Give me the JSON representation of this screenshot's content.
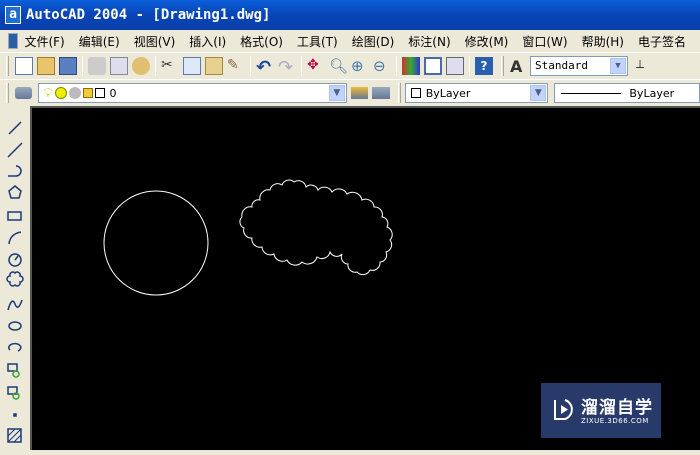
{
  "window": {
    "title": "AutoCAD 2004 - [Drawing1.dwg]",
    "app_icon": "a"
  },
  "menu": [
    "文件(F)",
    "编辑(E)",
    "视图(V)",
    "插入(I)",
    "格式(O)",
    "工具(T)",
    "绘图(D)",
    "标注(N)",
    "修改(M)",
    "窗口(W)",
    "帮助(H)",
    "电子签名"
  ],
  "toolbar": {
    "text_style": "Standard"
  },
  "layers": {
    "current_layer": "0",
    "color": "ByLayer",
    "linetype": "ByLayer"
  },
  "watermark": {
    "name": "溜溜自学",
    "url": "ZIXUE.3D66.COM"
  },
  "colors": {
    "title_bar": "#0a5fd8",
    "canvas": "#000000",
    "chrome": "#ece9d8",
    "watermark": "#273a69"
  }
}
